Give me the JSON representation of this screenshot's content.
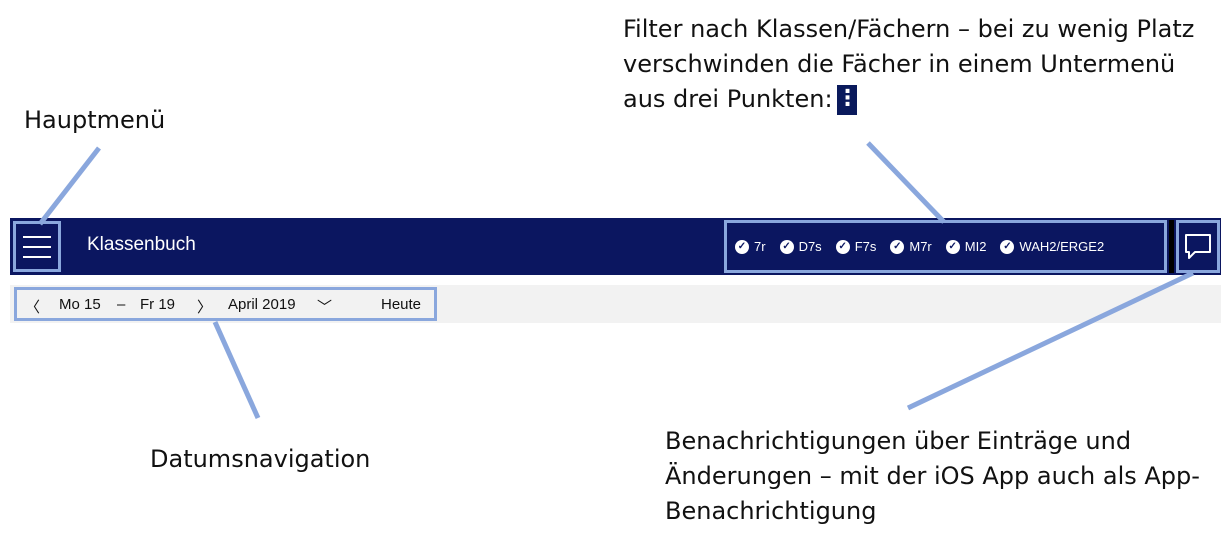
{
  "annotations": {
    "main_menu": "Hauptmenü",
    "filter": "Filter nach Klassen/Fächern – bei zu wenig Platz verschwinden die Fächer in einem Untermenü aus drei Punkten:",
    "filter_dots": "⋮",
    "date_nav": "Datumsnavigation",
    "notifications": "Benachrichtigungen über Einträge und Änderungen – mit der iOS App auch als App-Benachrichtigung"
  },
  "appbar": {
    "title": "Klassenbuch",
    "filters": [
      {
        "label": "7r",
        "icon": "check-circle-icon"
      },
      {
        "label": "D7s",
        "icon": "check-circle-icon"
      },
      {
        "label": "F7s",
        "icon": "check-circle-icon"
      },
      {
        "label": "M7r",
        "icon": "check-circle-icon"
      },
      {
        "label": "MI2",
        "icon": "check-circle-icon"
      },
      {
        "label": "WAH2/ERGE2",
        "icon": "check-circle-icon"
      }
    ],
    "notify_icon": "chat-bubble-icon",
    "menu_icon": "hamburger-icon"
  },
  "datebar": {
    "prev": "〈",
    "start": "Mo 15",
    "dash": "–",
    "end": "Fr 19",
    "next": "〉",
    "month": "April 2019",
    "month_chevron": "﹀",
    "today": "Heute"
  },
  "colors": {
    "appbar_bg": "#0b1660",
    "highlight": "#8aa7dd",
    "datebar_bg": "#f2f2f2"
  }
}
